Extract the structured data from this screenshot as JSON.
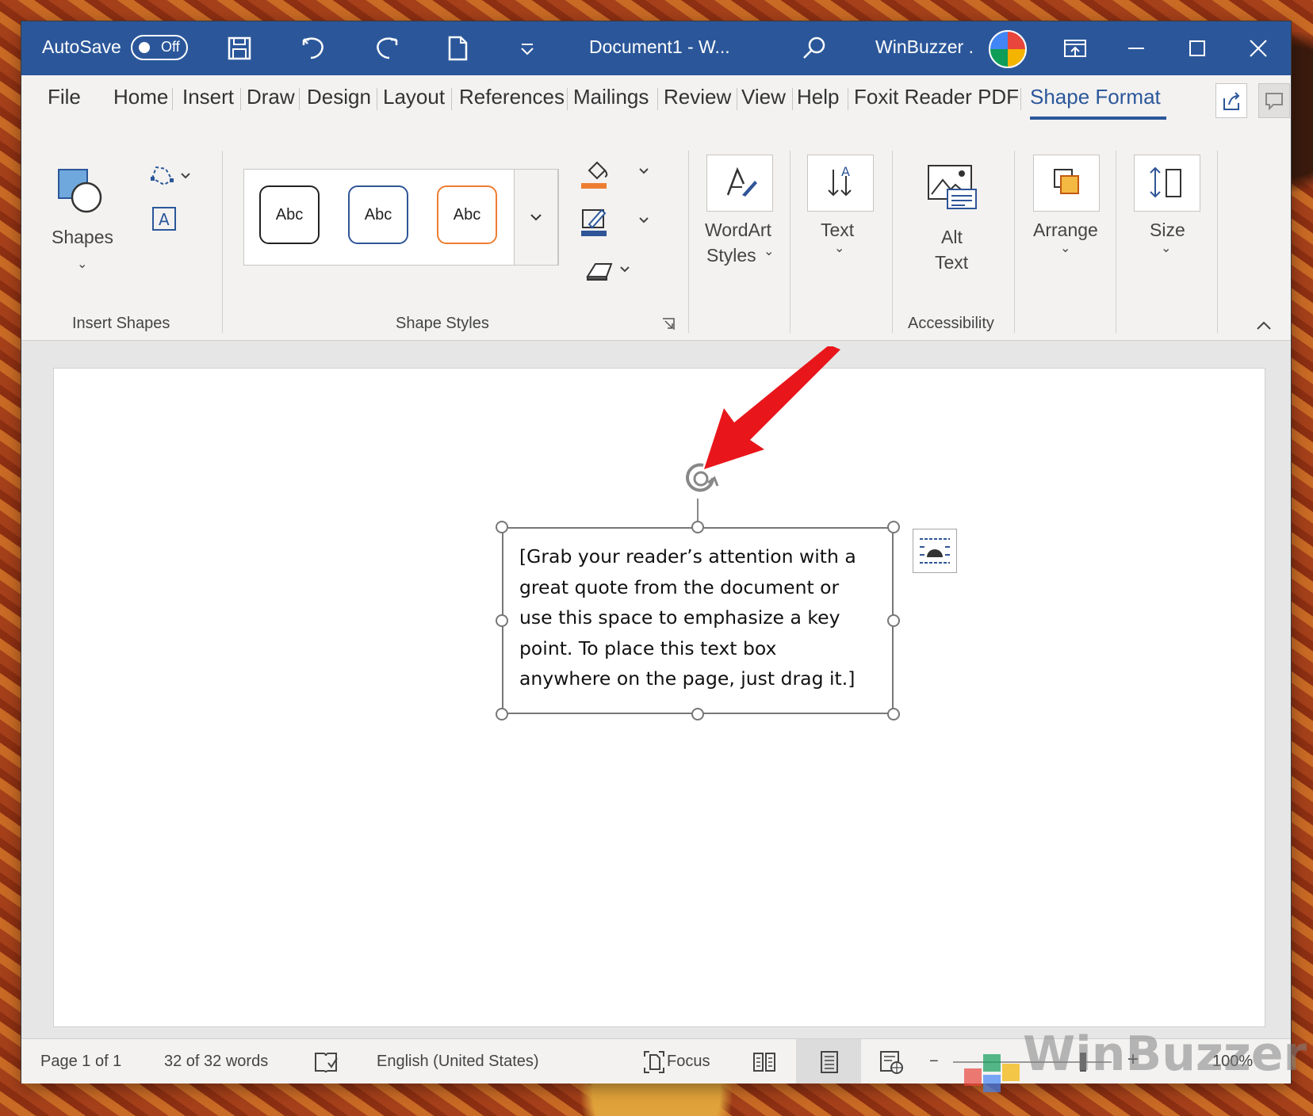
{
  "titlebar": {
    "autosave_label": "AutoSave",
    "autosave_state": "Off",
    "document_title": "Document1  -  W...",
    "account_name": "WinBuzzer ."
  },
  "tabs": [
    {
      "label": "File"
    },
    {
      "label": "Home"
    },
    {
      "label": "Insert"
    },
    {
      "label": "Draw"
    },
    {
      "label": "Design"
    },
    {
      "label": "Layout"
    },
    {
      "label": "References"
    },
    {
      "label": "Mailings"
    },
    {
      "label": "Review"
    },
    {
      "label": "View"
    },
    {
      "label": "Help"
    },
    {
      "label": "Foxit Reader PDF"
    },
    {
      "label": "Shape Format",
      "active": true
    }
  ],
  "ribbon": {
    "shapes_label": "Shapes",
    "insert_shapes_group": "Insert Shapes",
    "style_samples": [
      "Abc",
      "Abc",
      "Abc"
    ],
    "shape_styles_group": "Shape Styles",
    "wordart_line1": "WordArt",
    "wordart_line2": "Styles",
    "text_label": "Text",
    "alt_text_line1": "Alt",
    "alt_text_line2": "Text",
    "accessibility_group": "Accessibility",
    "arrange_label": "Arrange",
    "size_label": "Size"
  },
  "document": {
    "textbox_lines": [
      "[Grab your reader’s attention with a",
      "great quote from the document or",
      "use this space to emphasize a key",
      "point. To place this text box",
      "anywhere on the page, just drag it.]"
    ]
  },
  "statusbar": {
    "page": "Page 1 of 1",
    "words": "32 of 32 words",
    "language": "English (United States)",
    "focus": "Focus",
    "zoom": "100%"
  },
  "watermark": "WinBuzzer",
  "colors": {
    "titlebar": "#2b579a",
    "accent": "#2b579a",
    "arrow": "#e8161b",
    "style_outline_1": "#222222",
    "style_outline_2": "#2f5597",
    "style_outline_3": "#ed7d31"
  }
}
